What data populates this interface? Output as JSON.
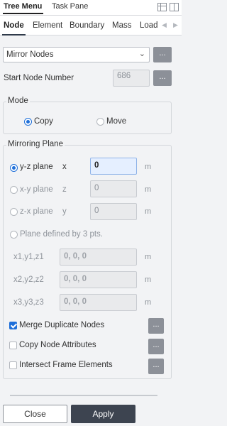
{
  "top_tabs": {
    "tree_menu": "Tree Menu",
    "task_pane": "Task Pane"
  },
  "sub_tabs": [
    "Node",
    "Element",
    "Boundary",
    "Mass",
    "Load"
  ],
  "function_select": {
    "value": "Mirror Nodes"
  },
  "dots": "...",
  "start_node": {
    "label": "Start Node Number",
    "value": "686"
  },
  "mode": {
    "title": "Mode",
    "options": [
      "Copy",
      "Move"
    ],
    "selected": "Copy"
  },
  "mirroring_plane": {
    "title": "Mirroring Plane",
    "planes": [
      {
        "label": "y-z plane",
        "axis": "x",
        "value": "0",
        "unit": "m",
        "selected": true
      },
      {
        "label": "x-y plane",
        "axis": "z",
        "value": "0",
        "unit": "m",
        "selected": false
      },
      {
        "label": "z-x plane",
        "axis": "y",
        "value": "0",
        "unit": "m",
        "selected": false
      }
    ],
    "three_points": {
      "label": "Plane defined by 3 pts.",
      "points": [
        {
          "label": "x1,y1,z1",
          "value": "0, 0, 0",
          "unit": "m"
        },
        {
          "label": "x2,y2,z2",
          "value": "0, 0, 0",
          "unit": "m"
        },
        {
          "label": "x3,y3,z3",
          "value": "0, 0, 0",
          "unit": "m"
        }
      ]
    }
  },
  "options": [
    {
      "label": "Merge Duplicate Nodes",
      "checked": true
    },
    {
      "label": "Copy Node Attributes",
      "checked": false
    },
    {
      "label": "Intersect Frame Elements",
      "checked": false
    }
  ],
  "buttons": {
    "close": "Close",
    "apply": "Apply"
  }
}
